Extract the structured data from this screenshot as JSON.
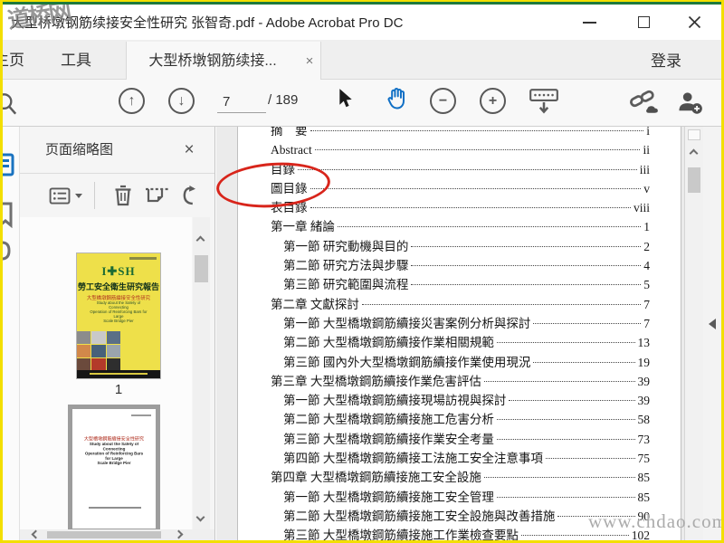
{
  "window": {
    "title": "大型桥墩钢筋续接安全性研究 张智奇.pdf - Adobe Acrobat Pro DC"
  },
  "tabs": {
    "home": "主页",
    "tools": "工具",
    "document": "大型桥墩钢筋续接...",
    "close_glyph": "×",
    "help_glyph": "?",
    "sign_in": "登录"
  },
  "toolbar": {
    "page_current": "7",
    "page_total": "/ 189",
    "prev_glyph": "↑",
    "next_glyph": "↓",
    "zoom_out_glyph": "−",
    "zoom_in_glyph": "+"
  },
  "panel": {
    "title": "页面缩略图",
    "close_glyph": "×",
    "page1_label": "1"
  },
  "cover": {
    "brand": "I✚SH",
    "title": "勞工安全衛生研究報告",
    "subtitle": "大型橋墩鋼筋續接安全性研究",
    "en_line1": "Study about the Safety of Connecting",
    "en_line2": "Operation of Reinforcing Bars for Large",
    "en_line3": "Scale Bridge Pier"
  },
  "toc": {
    "items": [
      {
        "t": "摘　要",
        "p": "i",
        "lvl": 0
      },
      {
        "t": "Abstract",
        "p": "ii",
        "lvl": 0
      },
      {
        "t": "目錄",
        "p": "iii",
        "lvl": 0
      },
      {
        "t": "圖目錄",
        "p": "v",
        "lvl": 0
      },
      {
        "t": "表目錄",
        "p": "viii",
        "lvl": 0
      },
      {
        "t": "第一章 緒論",
        "p": "1",
        "lvl": 0
      },
      {
        "t": "第一節 研究動機與目的",
        "p": "2",
        "lvl": 1
      },
      {
        "t": "第二節 研究方法與步驟",
        "p": "4",
        "lvl": 1
      },
      {
        "t": "第三節 研究範圍與流程",
        "p": "5",
        "lvl": 1
      },
      {
        "t": "第二章 文獻探討",
        "p": "7",
        "lvl": 0
      },
      {
        "t": "第一節 大型橋墩鋼筋續接災害案例分析與探討",
        "p": "7",
        "lvl": 1
      },
      {
        "t": "第二節 大型橋墩鋼筋續接作業相關規範",
        "p": "13",
        "lvl": 1
      },
      {
        "t": "第三節 國內外大型橋墩鋼筋續接作業使用現況",
        "p": "19",
        "lvl": 1
      },
      {
        "t": "第三章 大型橋墩鋼筋續接作業危害評估",
        "p": "39",
        "lvl": 0
      },
      {
        "t": "第一節 大型橋墩鋼筋續接現場訪視與探討",
        "p": "39",
        "lvl": 1
      },
      {
        "t": "第二節 大型橋墩鋼筋續接施工危害分析",
        "p": "58",
        "lvl": 1
      },
      {
        "t": "第三節 大型橋墩鋼筋續接作業安全考量",
        "p": "73",
        "lvl": 1
      },
      {
        "t": "第四節 大型橋墩鋼筋續接工法施工安全注意事項",
        "p": "75",
        "lvl": 1
      },
      {
        "t": "第四章 大型橋墩鋼筋續接施工安全設施",
        "p": "85",
        "lvl": 0
      },
      {
        "t": "第一節 大型橋墩鋼筋續接施工安全管理",
        "p": "85",
        "lvl": 1
      },
      {
        "t": "第二節 大型橋墩鋼筋續接施工安全設施與改善措施",
        "p": "90",
        "lvl": 1
      },
      {
        "t": "第三節 大型橋墩鋼筋續接施工作業檢查要點",
        "p": "102",
        "lvl": 1
      }
    ]
  },
  "watermarks": {
    "site_logo": "道桥网",
    "site_url": "www.chdao.com"
  },
  "icons": {
    "search": "magnifier",
    "previous-page": "up-arrow-circle",
    "next-page": "down-arrow-circle",
    "select-tool": "cursor-arrow",
    "hand-tool": "hand",
    "zoom-out": "minus-circle",
    "zoom-in": "plus-circle",
    "page-display": "toolbar-with-down-arrow",
    "send-link": "chain-cloud",
    "share": "person-plus",
    "annotation": "red-ellipse"
  },
  "colors": {
    "accent_blue": "#0f6fc5",
    "annotation_red": "#d8251b",
    "frame_yellow": "#f3df00",
    "frame_green": "#1e7a3c",
    "toolbar_bg": "#f8f8f8"
  }
}
